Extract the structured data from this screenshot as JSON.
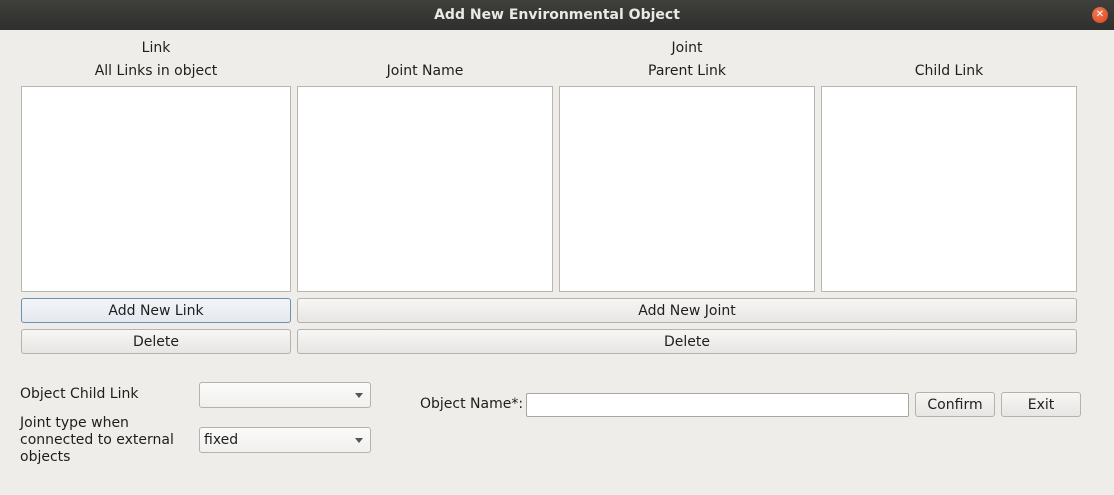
{
  "window": {
    "title": "Add New Environmental Object"
  },
  "link_section": {
    "heading": "Link",
    "column_label": "All Links in object",
    "add_button": "Add New Link",
    "delete_button": "Delete"
  },
  "joint_section": {
    "heading": "Joint",
    "columns": [
      "Joint Name",
      "Parent Link",
      "Child Link"
    ],
    "add_button": "Add New Joint",
    "delete_button": "Delete"
  },
  "bottom": {
    "object_child_link_label": "Object Child Link",
    "object_child_link_value": "",
    "joint_type_label": "Joint type when connected to external objects",
    "joint_type_value": "fixed",
    "object_name_label": "Object Name*:",
    "object_name_value": "",
    "confirm_button": "Confirm",
    "exit_button": "Exit"
  },
  "icons": {
    "close": "close-icon",
    "dropdown": "chevron-down-icon"
  }
}
